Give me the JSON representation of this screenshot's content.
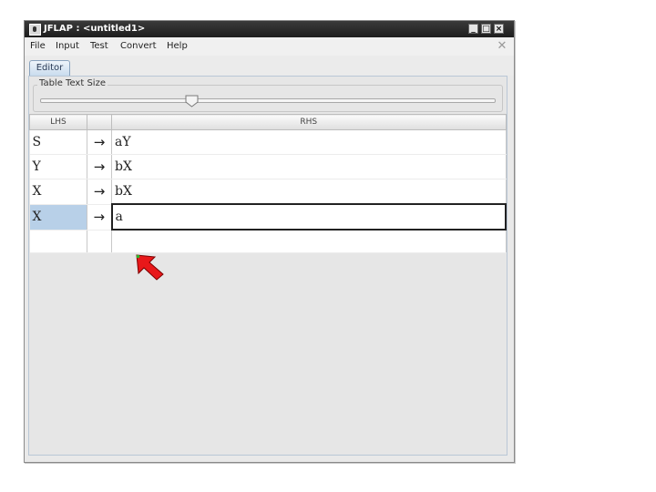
{
  "window": {
    "title": "JFLAP : <untitled1>"
  },
  "menu": [
    "File",
    "Input",
    "Test",
    "Convert",
    "Help"
  ],
  "tabs": [
    "Editor"
  ],
  "slider": {
    "label": "Table Text Size"
  },
  "table": {
    "headers": {
      "lhs": "LHS",
      "rhs": "RHS"
    },
    "arrow": "→",
    "rows": [
      {
        "lhs": "S",
        "rhs": "aY"
      },
      {
        "lhs": "Y",
        "rhs": "bX"
      },
      {
        "lhs": "X",
        "rhs": "bX"
      },
      {
        "lhs": "X",
        "rhs": "a"
      }
    ]
  },
  "colors": {
    "selection": "#b8d0e8",
    "cursor": "#e8181a",
    "titlebar": "#2a2a2a"
  }
}
